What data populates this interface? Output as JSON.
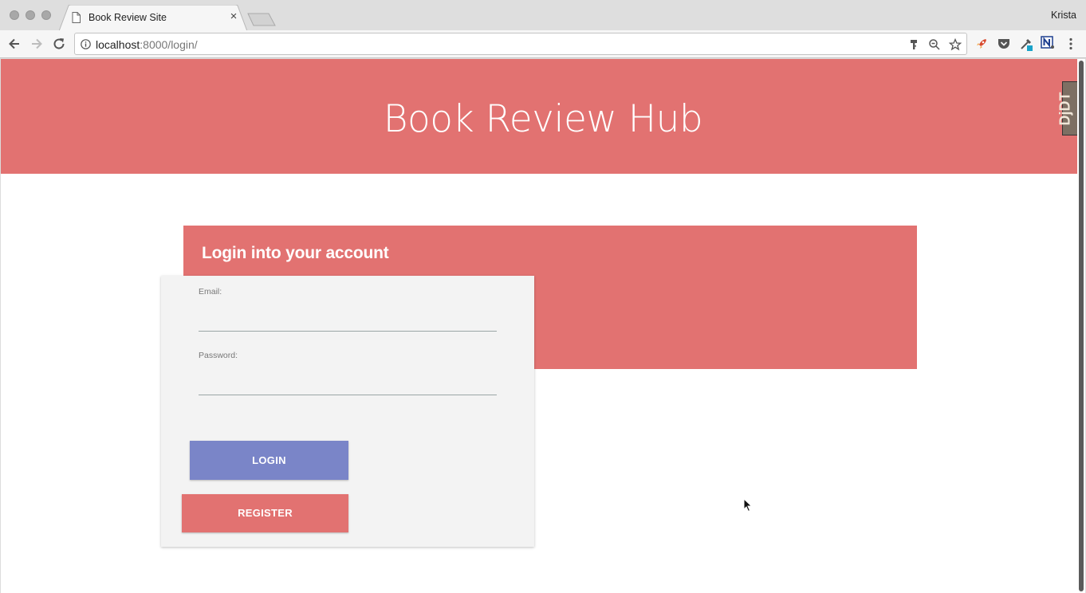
{
  "browser": {
    "tab_title": "Book Review Site",
    "tab_close": "×",
    "profile_name": "Krista",
    "url_host": "localhost",
    "url_rest": ":8000/login/"
  },
  "page": {
    "site_title": "Book Review Hub",
    "login_heading": "Login into your account",
    "form": {
      "email_label": "Email:",
      "email_value": "",
      "password_label": "Password:",
      "password_value": ""
    },
    "login_button": "LOGIN",
    "register_button": "REGISTER",
    "dbt_badge": "DjDT"
  },
  "colors": {
    "brand": "#e27271",
    "login_button": "#7a85c8",
    "card_bg": "#f3f3f3"
  }
}
